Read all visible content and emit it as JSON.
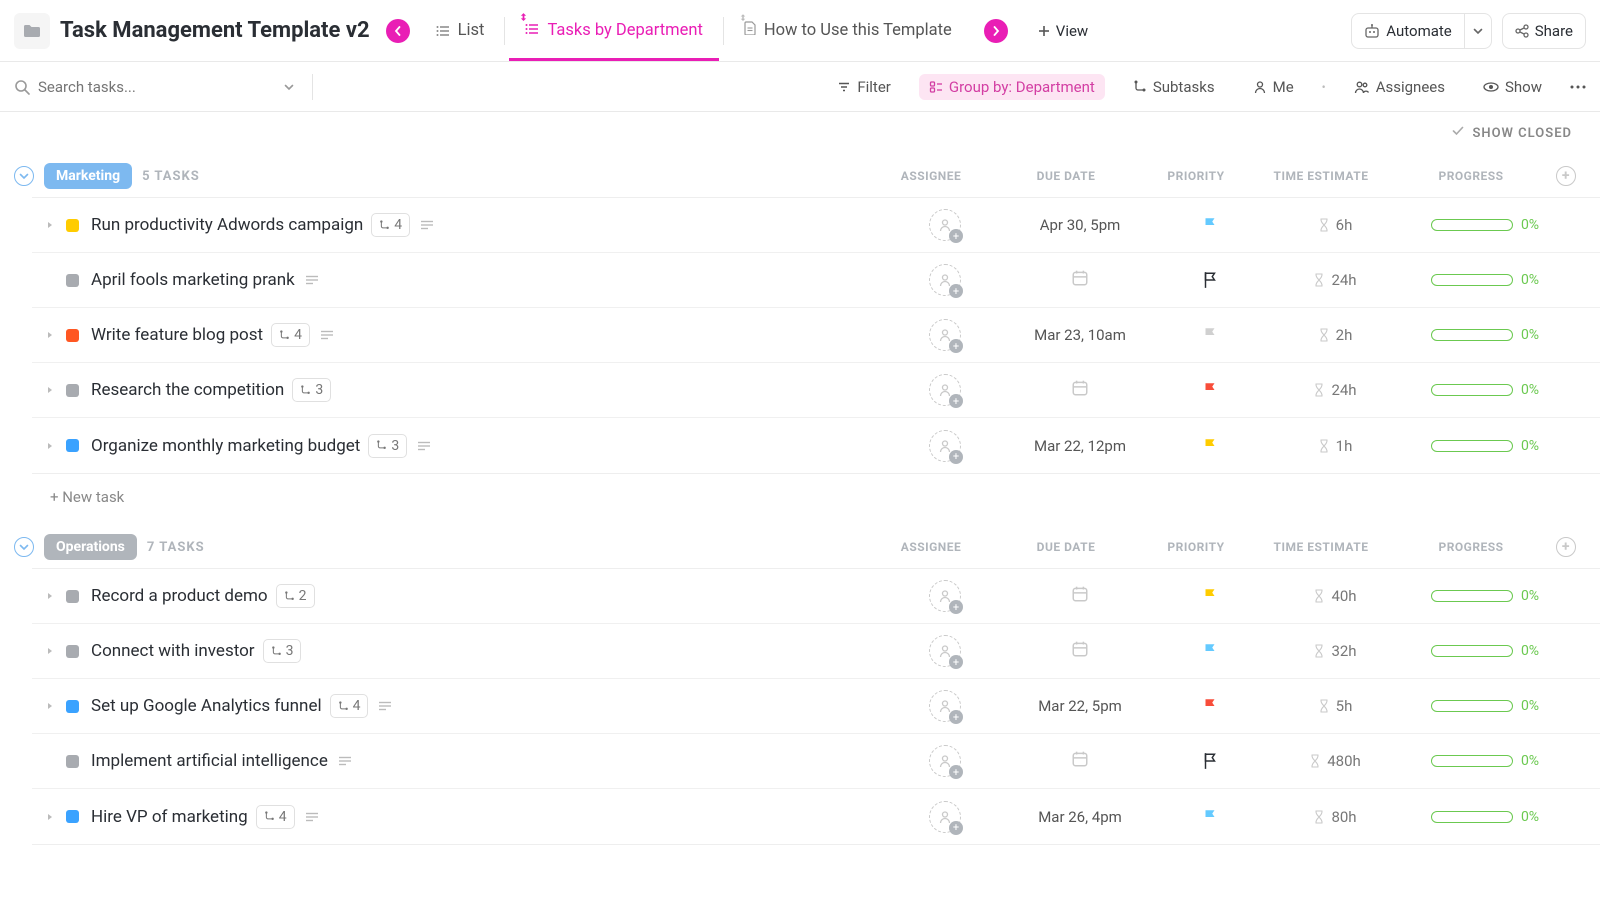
{
  "header": {
    "title": "Task Management Template v2",
    "tabs": [
      {
        "label": "List",
        "icon": "list"
      },
      {
        "label": "Tasks by Department",
        "icon": "list-pin",
        "active": true
      },
      {
        "label": "How to Use this Template",
        "icon": "doc-pin"
      }
    ],
    "view_label": "View",
    "automate_label": "Automate",
    "share_label": "Share"
  },
  "toolbar": {
    "search_placeholder": "Search tasks...",
    "filter_label": "Filter",
    "group_by_label": "Group by: Department",
    "subtasks_label": "Subtasks",
    "me_label": "Me",
    "assignees_label": "Assignees",
    "show_label": "Show"
  },
  "show_closed_label": "SHOW CLOSED",
  "columns": {
    "assignee": "ASSIGNEE",
    "due_date": "DUE DATE",
    "priority": "PRIORITY",
    "time_estimate": "TIME ESTIMATE",
    "progress": "PROGRESS"
  },
  "new_task_label": "+ New task",
  "groups": [
    {
      "name": "Marketing",
      "count_label": "5 TASKS",
      "color": "blue",
      "tasks": [
        {
          "status": "#ffcc00",
          "name": "Run productivity Adwords campaign",
          "subtasks": "4",
          "desc": true,
          "caret": true,
          "due": "Apr 30, 5pm",
          "priority": "blue",
          "time": "6h",
          "progress": "0%"
        },
        {
          "status": "#a8abb0",
          "name": "April fools marketing prank",
          "subtasks": null,
          "desc": true,
          "caret": false,
          "due": "",
          "priority": "outline",
          "time": "24h",
          "progress": "0%"
        },
        {
          "status": "#ff5722",
          "name": "Write feature blog post",
          "subtasks": "4",
          "desc": true,
          "caret": true,
          "due": "Mar 23, 10am",
          "priority": "gray",
          "time": "2h",
          "progress": "0%"
        },
        {
          "status": "#a8abb0",
          "name": "Research the competition",
          "subtasks": "3",
          "desc": false,
          "caret": true,
          "due": "",
          "priority": "red",
          "time": "24h",
          "progress": "0%"
        },
        {
          "status": "#3aa2ff",
          "name": "Organize monthly marketing budget",
          "subtasks": "3",
          "desc": true,
          "caret": true,
          "due": "Mar 22, 12pm",
          "priority": "yellow",
          "time": "1h",
          "progress": "0%"
        }
      ]
    },
    {
      "name": "Operations",
      "count_label": "7 TASKS",
      "color": "gray",
      "tasks": [
        {
          "status": "#a8abb0",
          "name": "Record a product demo",
          "subtasks": "2",
          "desc": false,
          "caret": true,
          "due": "",
          "priority": "yellow",
          "time": "40h",
          "progress": "0%"
        },
        {
          "status": "#a8abb0",
          "name": "Connect with investor",
          "subtasks": "3",
          "desc": false,
          "caret": true,
          "due": "",
          "priority": "blue",
          "time": "32h",
          "progress": "0%"
        },
        {
          "status": "#3aa2ff",
          "name": "Set up Google Analytics funnel",
          "subtasks": "4",
          "desc": true,
          "caret": true,
          "due": "Mar 22, 5pm",
          "priority": "red",
          "time": "5h",
          "progress": "0%"
        },
        {
          "status": "#a8abb0",
          "name": "Implement artificial intelligence",
          "subtasks": null,
          "desc": true,
          "caret": false,
          "due": "",
          "priority": "outline",
          "time": "480h",
          "progress": "0%"
        },
        {
          "status": "#3aa2ff",
          "name": "Hire VP of marketing",
          "subtasks": "4",
          "desc": true,
          "caret": true,
          "due": "Mar 26, 4pm",
          "priority": "blue",
          "time": "80h",
          "progress": "0%"
        }
      ]
    }
  ]
}
